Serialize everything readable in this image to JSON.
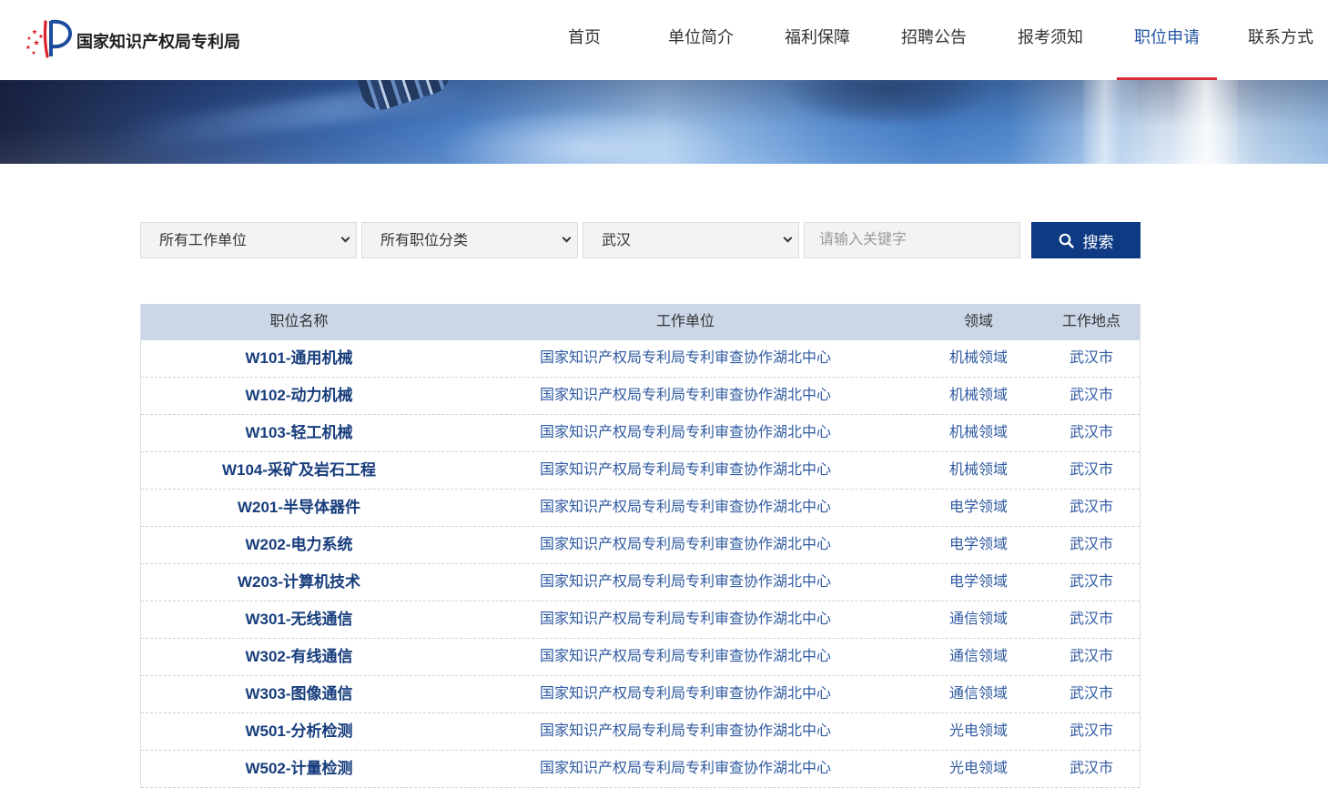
{
  "header": {
    "logo_text": "国家知识产权局专利局",
    "nav": [
      {
        "label": "首页",
        "active": false
      },
      {
        "label": "单位简介",
        "active": false
      },
      {
        "label": "福利保障",
        "active": false
      },
      {
        "label": "招聘公告",
        "active": false
      },
      {
        "label": "报考须知",
        "active": false
      },
      {
        "label": "职位申请",
        "active": true
      },
      {
        "label": "联系方式",
        "active": false
      }
    ]
  },
  "search": {
    "unit_select": "所有工作单位",
    "category_select": "所有职位分类",
    "location_select": "武汉",
    "keyword_input": {
      "value": "",
      "placeholder": "请输入关键字"
    },
    "button_label": "搜索"
  },
  "table": {
    "columns": [
      "职位名称",
      "工作单位",
      "领域",
      "工作地点"
    ],
    "rows": [
      {
        "name": "W101-通用机械",
        "unit": "国家知识产权局专利局专利审查协作湖北中心",
        "field": "机械领域",
        "location": "武汉市"
      },
      {
        "name": "W102-动力机械",
        "unit": "国家知识产权局专利局专利审查协作湖北中心",
        "field": "机械领域",
        "location": "武汉市"
      },
      {
        "name": "W103-轻工机械",
        "unit": "国家知识产权局专利局专利审查协作湖北中心",
        "field": "机械领域",
        "location": "武汉市"
      },
      {
        "name": "W104-采矿及岩石工程",
        "unit": "国家知识产权局专利局专利审查协作湖北中心",
        "field": "机械领域",
        "location": "武汉市"
      },
      {
        "name": "W201-半导体器件",
        "unit": "国家知识产权局专利局专利审查协作湖北中心",
        "field": "电学领域",
        "location": "武汉市"
      },
      {
        "name": "W202-电力系统",
        "unit": "国家知识产权局专利局专利审查协作湖北中心",
        "field": "电学领域",
        "location": "武汉市"
      },
      {
        "name": "W203-计算机技术",
        "unit": "国家知识产权局专利局专利审查协作湖北中心",
        "field": "电学领域",
        "location": "武汉市"
      },
      {
        "name": "W301-无线通信",
        "unit": "国家知识产权局专利局专利审查协作湖北中心",
        "field": "通信领域",
        "location": "武汉市"
      },
      {
        "name": "W302-有线通信",
        "unit": "国家知识产权局专利局专利审查协作湖北中心",
        "field": "通信领域",
        "location": "武汉市"
      },
      {
        "name": "W303-图像通信",
        "unit": "国家知识产权局专利局专利审查协作湖北中心",
        "field": "通信领域",
        "location": "武汉市"
      },
      {
        "name": "W501-分析检测",
        "unit": "国家知识产权局专利局专利审查协作湖北中心",
        "field": "光电领域",
        "location": "武汉市"
      },
      {
        "name": "W502-计量检测",
        "unit": "国家知识产权局专利局专利审查协作湖北中心",
        "field": "光电领域",
        "location": "武汉市"
      }
    ]
  },
  "icons": {
    "logo": "cnipa-logo-icon",
    "search_button": "search-icon",
    "select_arrow": "chevron-down-icon"
  },
  "colors": {
    "accent": "#2457a6",
    "active_bar": "#d7303a",
    "button": "#0e3a84",
    "table_header": "#cbd6e7",
    "link": "#173d7c",
    "cell_text": "#2f5aa0"
  }
}
